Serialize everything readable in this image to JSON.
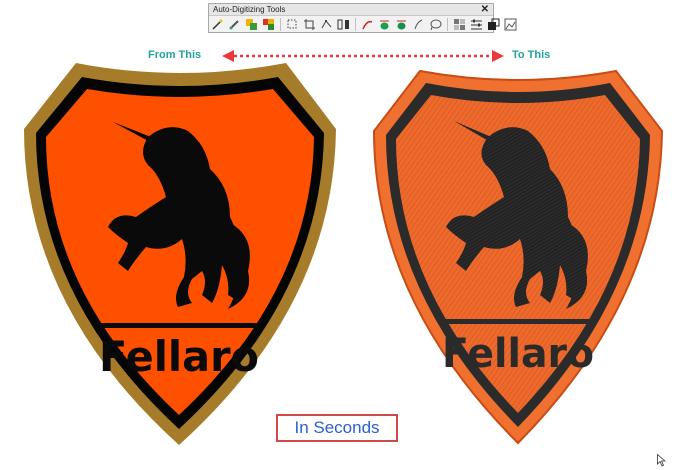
{
  "toolbar": {
    "title": "Auto-Digitizing Tools",
    "close_label": "✕",
    "tools": [
      "magic-wand-icon",
      "paint-brush-icon",
      "color-fill-icon",
      "color-reduce-icon",
      "trace-outline-icon",
      "crop-icon",
      "node-edit-icon",
      "straighten-icon",
      "running-stitch-icon",
      "fill-stitch-icon",
      "satin-stitch-icon",
      "freehand-icon",
      "lasso-icon",
      "bitmap-icon",
      "settings-sliders-icon",
      "layer-icon",
      "photo-stitch-icon"
    ]
  },
  "labels": {
    "from": "From This",
    "to": "To This",
    "in_seconds": "In Seconds"
  },
  "logo": {
    "brand_text": "Fellaro"
  },
  "colors": {
    "accent_teal": "#21a29a",
    "arrow_red": "#e8383c",
    "shield_orange": "#ff5000",
    "embroidery_orange": "#f07030",
    "gold_border": "#a67c2a",
    "blue_text": "#2b5fd0",
    "box_border": "#d04848"
  }
}
